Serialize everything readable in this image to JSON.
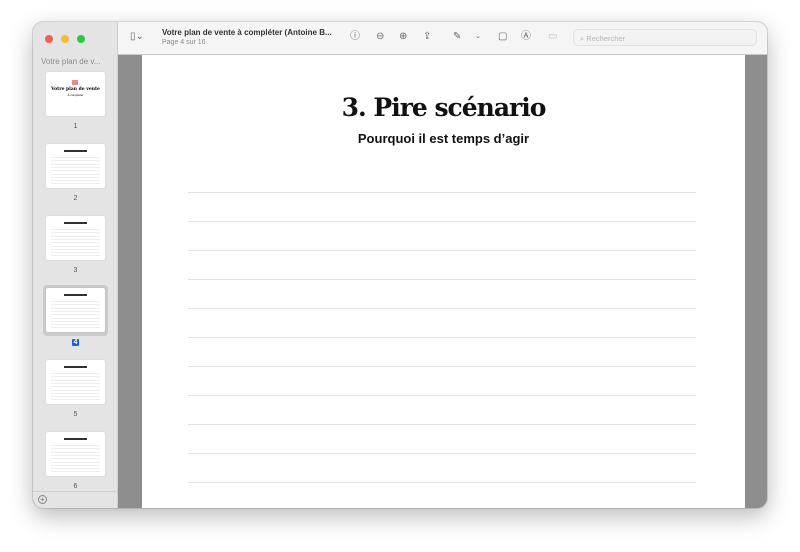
{
  "sidebar": {
    "title": "Votre plan de v...",
    "pages": [
      "1",
      "2",
      "3",
      "4",
      "5",
      "6"
    ],
    "selected_page": 4
  },
  "toolbar": {
    "doc_title": "Votre plan de vente à compléter (Antoine B...",
    "page_info": "Page 4 sur 16",
    "search_placeholder": "Rechercher"
  },
  "page": {
    "title": "3. Pire scénario",
    "subtitle": "Pourquoi il est temps d’agir",
    "line_count": 11
  },
  "thumb1": {
    "title": "Votre plan de vente",
    "sub": "À compléter"
  },
  "colors": {
    "accent": "#1a5fe0",
    "close": "#ee5f57",
    "min": "#f6be2f",
    "max": "#29c840"
  }
}
